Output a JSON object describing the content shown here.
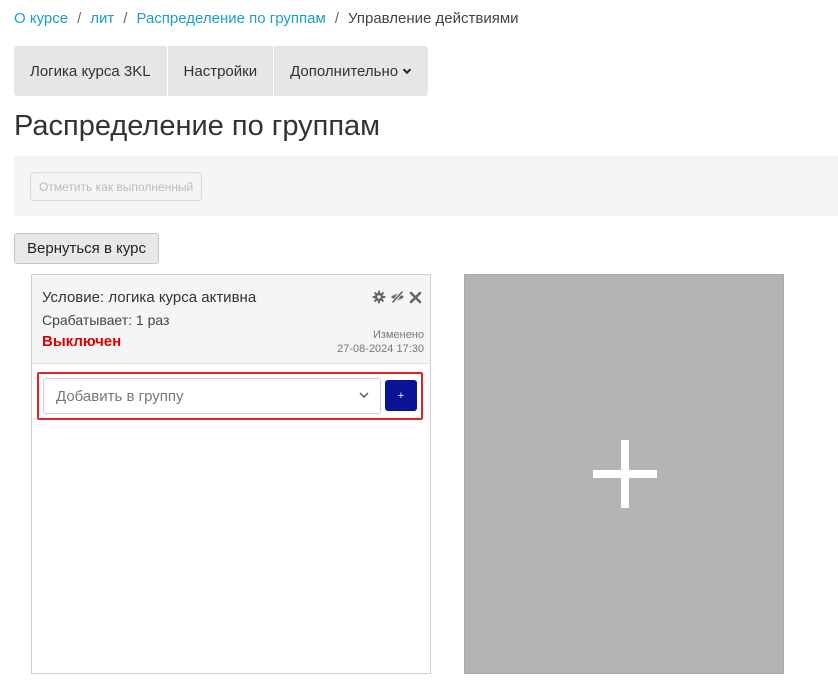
{
  "breadcrumb": {
    "items": [
      "О курсе",
      "лит",
      "Распределение по группам"
    ],
    "current": "Управление действиями",
    "separator": "/"
  },
  "nav": {
    "tabs": [
      "Логика курса 3KL",
      "Настройки",
      "Дополнительно"
    ]
  },
  "page": {
    "title": "Распределение по группам"
  },
  "completion": {
    "button_label": "Отметить как выполненный"
  },
  "back": {
    "label": "Вернуться в курс"
  },
  "rule_card": {
    "condition": "Условие: логика курса активна",
    "fires": "Срабатывает: 1 раз",
    "state": "Выключен",
    "modified_label": "Изменено",
    "modified_date": "27-08-2024 17:30",
    "icons": [
      "gear-icon",
      "eye-slash-icon",
      "close-icon"
    ],
    "action_select": {
      "placeholder": "Добавить в группу"
    },
    "add_button": "+"
  },
  "colors": {
    "link": "#1aa0c8",
    "state_off": "#e00000",
    "add_button": "#0a1494",
    "highlight_border": "#e0242d",
    "add_card_bg": "#b3b3b3"
  }
}
